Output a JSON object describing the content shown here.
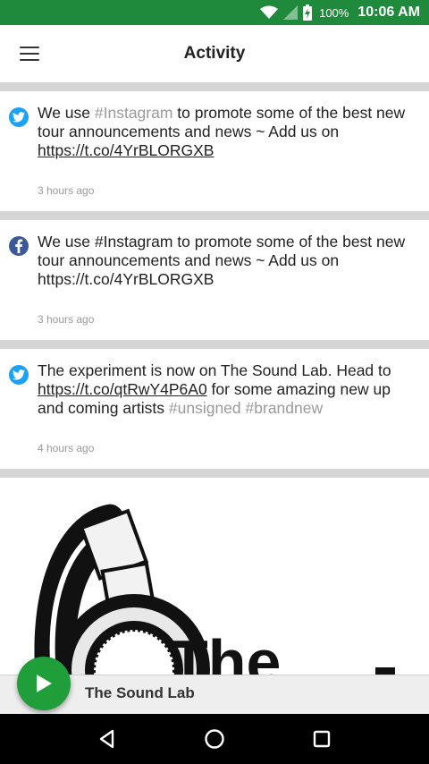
{
  "status_bar": {
    "battery_percent": "100%",
    "time": "10:06 AM"
  },
  "app_bar": {
    "title": "Activity",
    "menu_icon": "hamburger-menu-icon"
  },
  "posts": [
    {
      "source": "twitter",
      "text_parts": [
        "We use ",
        "#Instagram",
        " to promote some of the best new tour announcements and news ~ Add us on ",
        "https://t.co/4YrBLORGXB"
      ],
      "time": "3 hours ago"
    },
    {
      "source": "facebook",
      "text": "We use #Instagram to promote some of the best new tour announcements and news ~ Add us on https://t.co/4YrBLORGXB",
      "time": "3 hours ago"
    },
    {
      "source": "twitter",
      "text_parts": [
        "The experiment is now on The Sound Lab. Head to ",
        "https://t.co/qtRwY4P6A0",
        " for some amazing new up and coming artists ",
        "#unsigned",
        " ",
        "#brandnew"
      ],
      "time": "4 hours ago"
    }
  ],
  "player": {
    "title": "The Sound Lab",
    "play_icon": "play-icon"
  },
  "colors": {
    "status_bar": "#1f8a3c",
    "fab": "#1f9e3a",
    "twitter": "#1da1f2",
    "facebook": "#3b5998",
    "hashtag": "#9a9a9a"
  }
}
